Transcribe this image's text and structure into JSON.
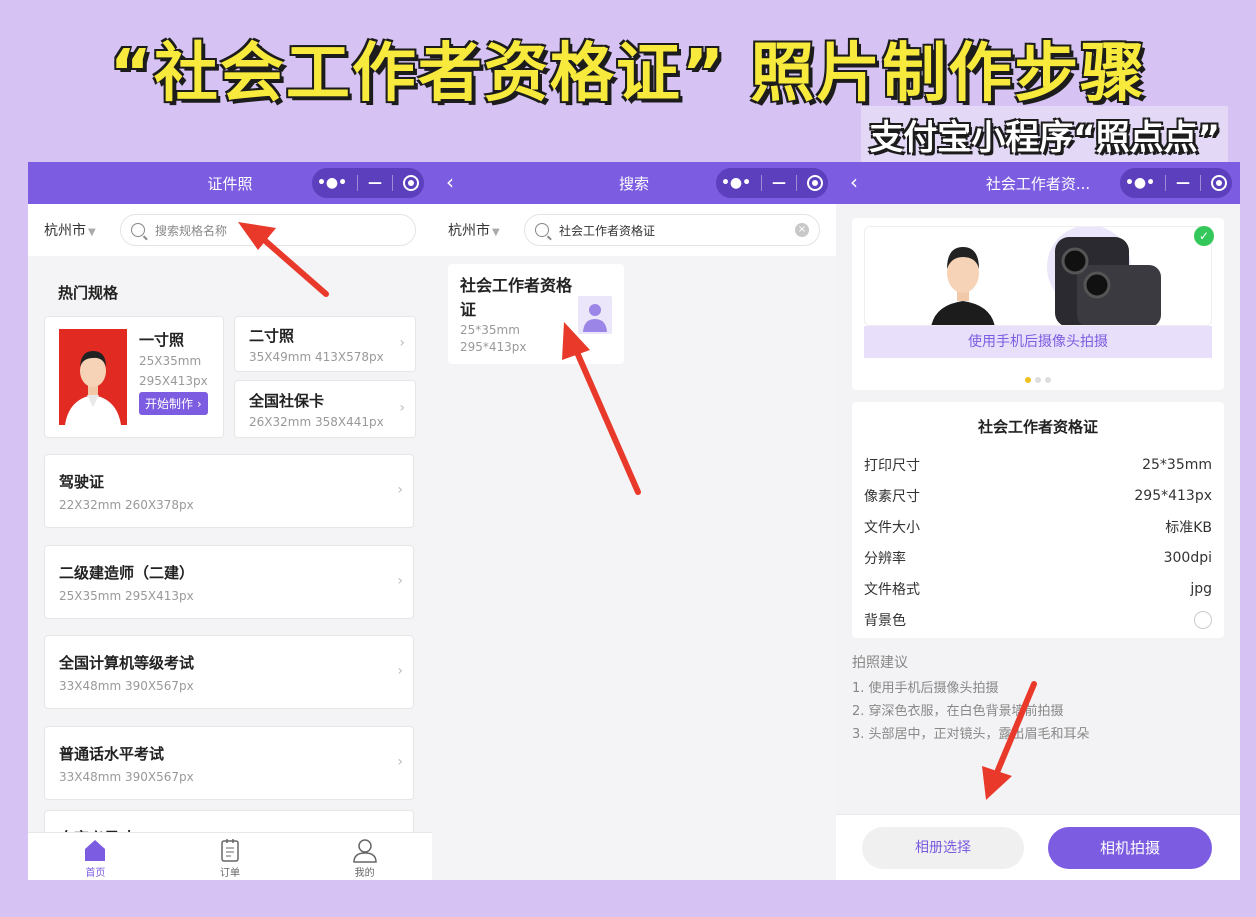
{
  "banner": {
    "title": "“社会工作者资格证” 照片制作步骤",
    "subtitle": "支付宝小程序“照点点”"
  },
  "screen1": {
    "nav_title": "证件照",
    "city": "杭州市",
    "search_placeholder": "搜索规格名称",
    "hot_label": "热门规格",
    "featured": {
      "title": "一寸照",
      "size_mm": "25X35mm",
      "size_px": "295X413px",
      "button": "开始制作 ›"
    },
    "small_cards": [
      {
        "title": "二寸照",
        "spec": "35X49mm 413X578px"
      },
      {
        "title": "全国社保卡",
        "spec": "26X32mm 358X441px"
      }
    ],
    "list": [
      {
        "title": "驾驶证",
        "spec": "22X32mm 260X378px"
      },
      {
        "title": "二级建造师（二建）",
        "spec": "25X35mm 295X413px"
      },
      {
        "title": "全国计算机等级考试",
        "spec": "33X48mm 390X567px"
      },
      {
        "title": "普通话水平考试",
        "spec": "33X48mm 390X567px"
      },
      {
        "title": "自定义尺寸",
        "spec": ""
      }
    ],
    "tabs": [
      {
        "label": "首页"
      },
      {
        "label": "订单"
      },
      {
        "label": "我的"
      }
    ]
  },
  "screen2": {
    "nav_title": "搜索",
    "city": "杭州市",
    "search_value": "社会工作者资格证",
    "result": {
      "title": "社会工作者资格证",
      "size_mm": "25*35mm",
      "size_px": "295*413px"
    }
  },
  "screen3": {
    "nav_title": "社会工作者资...",
    "hero_caption": "使用手机后摄像头拍摄",
    "spec_title": "社会工作者资格证",
    "rows": [
      {
        "label": "打印尺寸",
        "value": "25*35mm"
      },
      {
        "label": "像素尺寸",
        "value": "295*413px"
      },
      {
        "label": "文件大小",
        "value": "标准KB"
      },
      {
        "label": "分辨率",
        "value": "300dpi"
      },
      {
        "label": "文件格式",
        "value": "jpg"
      },
      {
        "label": "背景色",
        "value": ""
      }
    ],
    "tips_title": "拍照建议",
    "tips": [
      "1. 使用手机后摄像头拍摄",
      "2. 穿深色衣服，在白色背景墙前拍摄",
      "3. 头部居中，正对镜头，露出眉毛和耳朵"
    ],
    "album_button": "相册选择",
    "camera_button": "相机拍摄"
  },
  "colors": {
    "accent": "#7c5ce0",
    "background": "#d6c3f3",
    "banner_text": "#f8ea3d",
    "arrow": "#e8392b"
  }
}
